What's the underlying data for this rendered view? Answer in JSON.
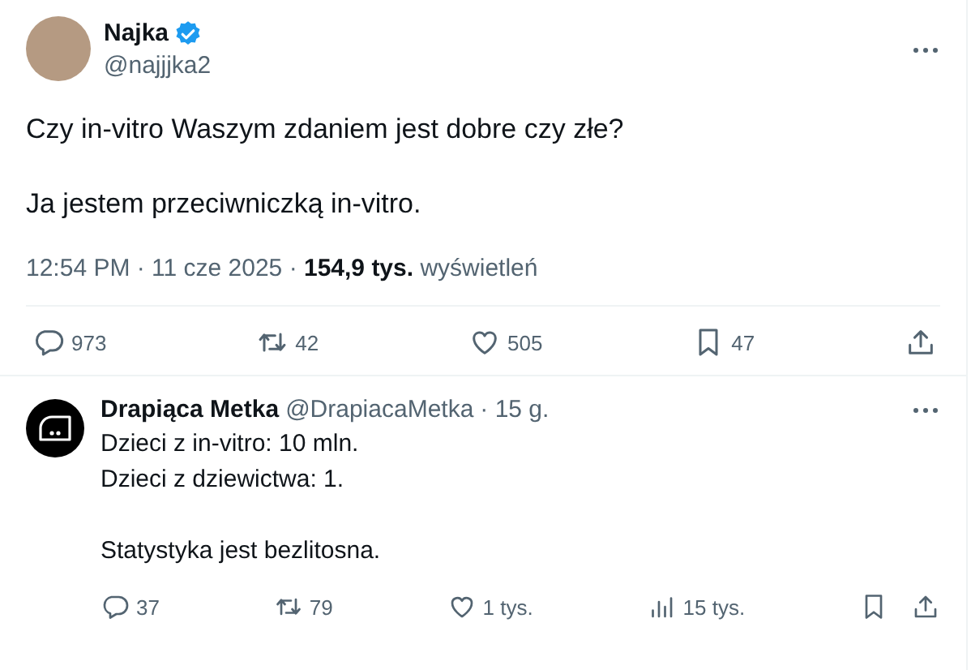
{
  "tweet": {
    "author": {
      "name": "Najka",
      "verified": true,
      "handle": "@najjjka2"
    },
    "paragraphs": [
      "Czy in-vitro Waszym zdaniem jest dobre czy złe?",
      "Ja jestem przeciwniczką in-vitro."
    ],
    "meta": "12:54 PM · 11 cze 2025 · **154,9 tys.** wyświetleń",
    "actions": [
      {
        "kind": "reply",
        "count": "973"
      },
      {
        "kind": "repost",
        "count": "42"
      },
      {
        "kind": "like",
        "count": "505"
      },
      {
        "kind": "bookmark",
        "count": "47"
      },
      {
        "kind": "share"
      }
    ]
  },
  "reply": {
    "author": {
      "name": "Drapiąca Metka",
      "handle": "@DrapiacaMetka",
      "time": "· 15 g."
    },
    "paragraphs": [
      [
        "Dzieci z in-vitro: 10 mln.",
        "Dzieci z dziewictwa: 1."
      ],
      [
        "Statystyka jest bezlitosna."
      ]
    ],
    "actions": [
      {
        "kind": "reply",
        "count": "37"
      },
      {
        "kind": "repost",
        "count": "79"
      },
      {
        "kind": "like",
        "count": "1 tys."
      },
      {
        "kind": "views",
        "count": "15 tys."
      },
      {
        "kind": "bookmark"
      },
      {
        "kind": "share"
      }
    ]
  }
}
